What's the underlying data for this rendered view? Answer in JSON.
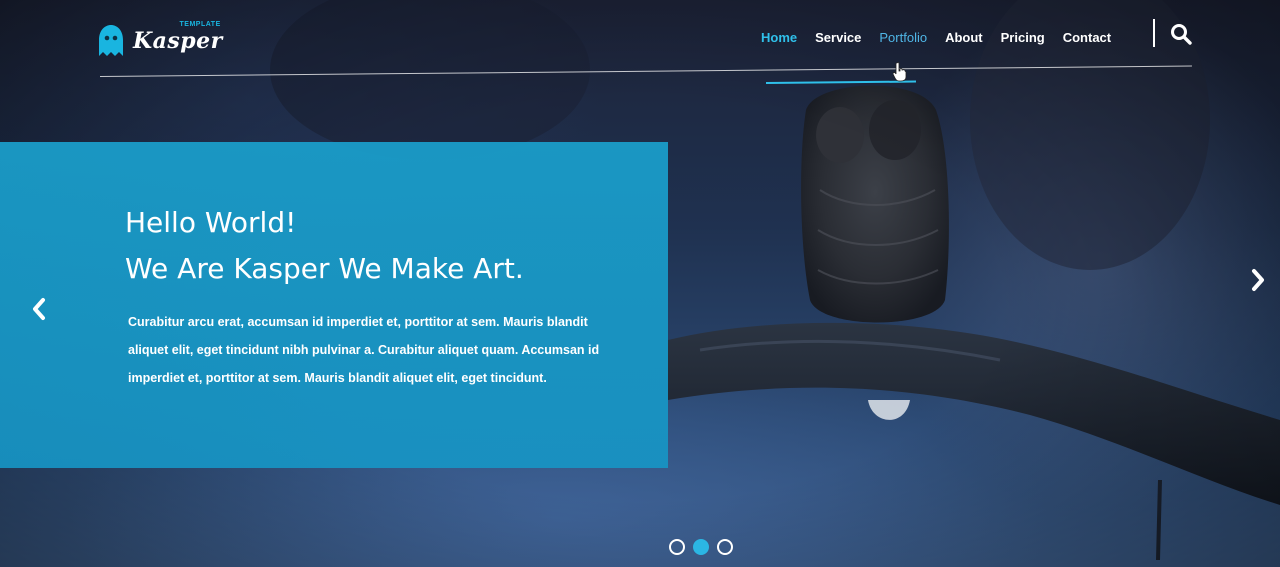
{
  "logo": {
    "tag": "TEMPLATE",
    "name": "Kasper",
    "icon": "ghost-icon",
    "accent": "#19b5e0"
  },
  "nav": {
    "items": [
      {
        "label": "Home",
        "state": "active"
      },
      {
        "label": "Service",
        "state": "normal"
      },
      {
        "label": "Portfolio",
        "state": "hover"
      },
      {
        "label": "About",
        "state": "normal"
      },
      {
        "label": "Pricing",
        "state": "normal"
      },
      {
        "label": "Contact",
        "state": "normal"
      }
    ],
    "search_icon": "search-icon",
    "active_color": "#2fc0ea"
  },
  "hero": {
    "headline_line1": "Hello World!",
    "headline_line2": "We Are Kasper We Make Art.",
    "paragraph": "Curabitur arcu erat, accumsan id imperdiet et, porttitor at sem. Mauris blandit aliquet elit, eget tincidunt nibh pulvinar a. Curabitur aliquet quam. Accumsan id imperdiet et, porttitor at sem. Mauris blandit aliquet elit, eget tincidunt.",
    "box_color": "#1aa0cd",
    "prev_icon": "chevron-left-icon",
    "next_icon": "chevron-right-icon"
  },
  "slider": {
    "slide_count": 3,
    "active_index": 1,
    "dot_active_color": "#2bb6e4"
  }
}
